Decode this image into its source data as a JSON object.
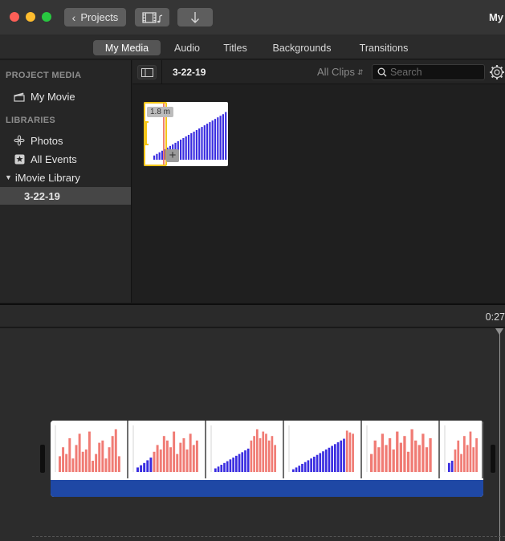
{
  "window": {
    "title": "My",
    "projects_label": "Projects"
  },
  "toolbar": {
    "media_icon": "film-music-icon",
    "import_icon": "import-arrow-icon"
  },
  "tabs": [
    {
      "label": "My Media",
      "active": true
    },
    {
      "label": "Audio",
      "active": false
    },
    {
      "label": "Titles",
      "active": false
    },
    {
      "label": "Backgrounds",
      "active": false
    },
    {
      "label": "Transitions",
      "active": false
    }
  ],
  "sidebar": {
    "project_media_header": "PROJECT MEDIA",
    "project_item": "My Movie",
    "libraries_header": "LIBRARIES",
    "photos": "Photos",
    "all_events": "All Events",
    "library_name": "iMovie Library",
    "event_selected": "3-22-19"
  },
  "browser": {
    "event_title": "3-22-19",
    "clips_filter": "All Clips",
    "search_placeholder": "Search",
    "clip": {
      "duration": "1.8 m",
      "bars_blue_ascending": [
        0.08,
        0.11,
        0.14,
        0.17,
        0.2,
        0.23,
        0.26,
        0.29,
        0.32,
        0.35,
        0.38,
        0.41,
        0.44,
        0.47,
        0.5,
        0.53,
        0.56,
        0.59,
        0.62,
        0.65,
        0.68,
        0.71,
        0.74,
        0.77,
        0.8,
        0.83,
        0.86,
        0.9
      ]
    }
  },
  "timeline": {
    "time_display": "0:27",
    "colors": {
      "red_bars": "#f07b74",
      "blue_bars": "#3a2de0",
      "audio_track": "#1f48a5"
    },
    "frames": [
      {
        "blue": [],
        "red": [
          0.35,
          0.55,
          0.4,
          0.75,
          0.3,
          0.6,
          0.85,
          0.45,
          0.5,
          0.9,
          0.25,
          0.4,
          0.65,
          0.7,
          0.3,
          0.55,
          0.8,
          0.95,
          0.35
        ]
      },
      {
        "blue": [
          0.1,
          0.15,
          0.2,
          0.26,
          0.32
        ],
        "red": [
          0.45,
          0.6,
          0.5,
          0.8,
          0.7,
          0.55,
          0.9,
          0.4,
          0.65,
          0.75,
          0.5,
          0.85,
          0.6,
          0.7
        ]
      },
      {
        "blue": [
          0.08,
          0.12,
          0.16,
          0.2,
          0.24,
          0.28,
          0.32,
          0.36,
          0.4,
          0.44,
          0.48,
          0.52
        ],
        "red": [
          0.7,
          0.8,
          0.95,
          0.75,
          0.9,
          0.85,
          0.7,
          0.8,
          0.6
        ]
      },
      {
        "blue": [
          0.06,
          0.1,
          0.14,
          0.18,
          0.22,
          0.26,
          0.3,
          0.34,
          0.38,
          0.42,
          0.46,
          0.5,
          0.54,
          0.58,
          0.62,
          0.66,
          0.7,
          0.74
        ],
        "red": [
          0.92,
          0.88,
          0.85
        ]
      },
      {
        "blue": [],
        "red": [
          0.4,
          0.7,
          0.55,
          0.85,
          0.6,
          0.75,
          0.5,
          0.9,
          0.65,
          0.8,
          0.45,
          0.95,
          0.7,
          0.6,
          0.85,
          0.55,
          0.75
        ]
      },
      {
        "blue": [
          0.2,
          0.25
        ],
        "red": [
          0.5,
          0.7,
          0.4,
          0.8,
          0.6,
          0.9,
          0.55,
          0.75
        ]
      }
    ]
  }
}
